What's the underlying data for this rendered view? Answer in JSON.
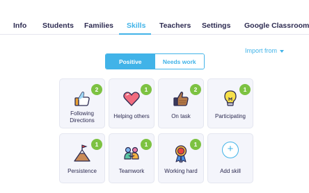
{
  "nav": {
    "tabs": [
      {
        "label": "Info"
      },
      {
        "label": "Students"
      },
      {
        "label": "Families"
      },
      {
        "label": "Skills"
      },
      {
        "label": "Teachers"
      },
      {
        "label": "Settings"
      },
      {
        "label": "Google Classroom"
      }
    ],
    "active_tab": "Skills"
  },
  "import_label": "Import from",
  "toggle": {
    "positive": "Positive",
    "needs_work": "Needs work",
    "selected": "Positive"
  },
  "skills": [
    {
      "label": "Following Directions",
      "count": "2",
      "icon": "thumbs-up-icon"
    },
    {
      "label": "Helping others",
      "count": "1",
      "icon": "heart-icon"
    },
    {
      "label": "On task",
      "count": "2",
      "icon": "thumbs-up-icon"
    },
    {
      "label": "Participating",
      "count": "1",
      "icon": "lightbulb-icon"
    },
    {
      "label": "Persistence",
      "count": "1",
      "icon": "mountain-flag-icon"
    },
    {
      "label": "Teamwork",
      "count": "1",
      "icon": "teamwork-icon"
    },
    {
      "label": "Working hard",
      "count": "1",
      "icon": "medal-icon"
    }
  ],
  "add_skill_label": "Add skill",
  "colors": {
    "accent": "#41b3e8",
    "badge": "#7dc242",
    "text": "#2c2a50",
    "card_bg": "#f4f5fb"
  }
}
